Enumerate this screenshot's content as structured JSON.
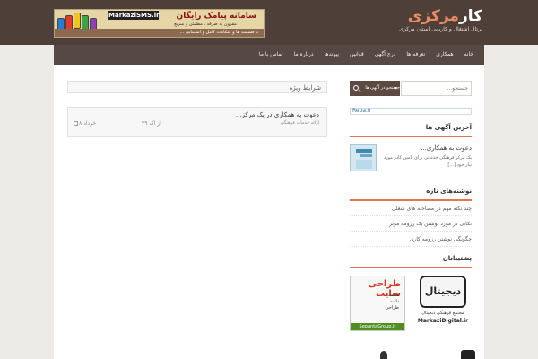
{
  "header": {
    "site_title_main": "کار",
    "site_title_accent": "مرکزی",
    "site_subtitle": "پرتال اشتغال و کاریابی استان مرکزی"
  },
  "banner": {
    "site_name": "MarkaziSMS.ir",
    "title": "سامانه پیامک رایگان",
    "line1": "مقرون به صرفه ، مطمئن و سریع",
    "bottom_text": "با قسمت ها و امکانات کامل و استثنایی ..."
  },
  "nav": {
    "items": [
      "خانه",
      "همکاری",
      "تعرفه ها",
      "درج آگهی",
      "قوانین",
      "پیوندها",
      "درباره ما",
      "تماس با ما"
    ]
  },
  "main": {
    "page_box": "شرایط ویژه",
    "post": {
      "title": "دعوت به همکاری در یک مرکز...",
      "category": "ارائه خدمات فرهنگی",
      "views": "۴۹ از اک",
      "date": "۸ خرداد"
    }
  },
  "sidebar": {
    "search_placeholder": "جستجو...",
    "search_button": "جستجو در آگهی ها",
    "reba_link": "Reba.ir",
    "latest_ads": {
      "title": "آخرین آگهی ها",
      "item_title": "دعوت به همکاری...",
      "item_desc": "یک مرکز فرهنگی خدماتی برای تامین کادر مورد نیاز خود [...]"
    },
    "notes": {
      "title": "نوشته‌های تازه",
      "items": [
        "چند نکته مهم در مصاحبه های شغلی",
        "نکاتی در مورد نوشتن یک رزومه موثر",
        "چگونگی نوشتن رزومه کاری"
      ]
    },
    "sponsors": {
      "title": "پشتیبانان",
      "digital_logo": "دیجیتال",
      "digital_name": "مجتمع فرهنگی دیجیتال",
      "digital_url": "MarkaziDigital.ir",
      "sepanta_title": "طراحی سایت",
      "sepanta_lines": [
        "هاست",
        "دامنه",
        "طراحی"
      ],
      "sepanta_url": "SepantaGroup.ir"
    }
  }
}
